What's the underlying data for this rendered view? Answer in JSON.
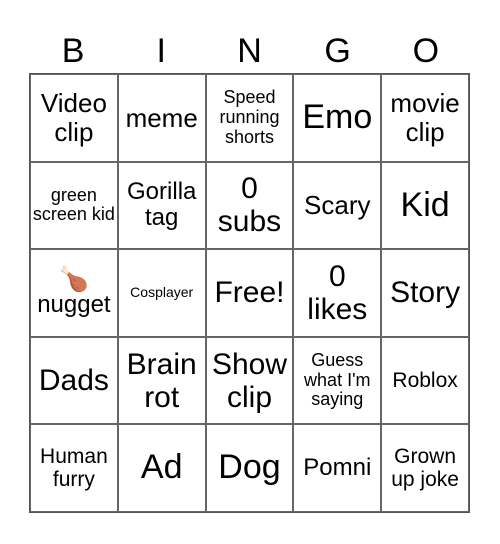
{
  "header": {
    "letters": [
      "B",
      "I",
      "N",
      "G",
      "O"
    ]
  },
  "cells": [
    {
      "text": "Video clip"
    },
    {
      "text": "meme"
    },
    {
      "text": "Speed running shorts"
    },
    {
      "text": "Emo"
    },
    {
      "text": "movie clip"
    },
    {
      "text": "green screen kid"
    },
    {
      "text": "Gorilla tag"
    },
    {
      "text": "0 subs"
    },
    {
      "text": "Scary"
    },
    {
      "text": "Kid"
    },
    {
      "text": "nugget",
      "icon": "🍗",
      "icon_name": "poultry-leg-icon"
    },
    {
      "text": "Cosplayer"
    },
    {
      "text": "Free!"
    },
    {
      "text": "0 likes"
    },
    {
      "text": "Story"
    },
    {
      "text": "Dads"
    },
    {
      "text": "Brain rot"
    },
    {
      "text": "Show clip"
    },
    {
      "text": "Guess what I'm saying"
    },
    {
      "text": "Roblox"
    },
    {
      "text": "Human furry"
    },
    {
      "text": "Ad"
    },
    {
      "text": "Dog"
    },
    {
      "text": "Pomni"
    },
    {
      "text": "Grown up joke"
    }
  ]
}
